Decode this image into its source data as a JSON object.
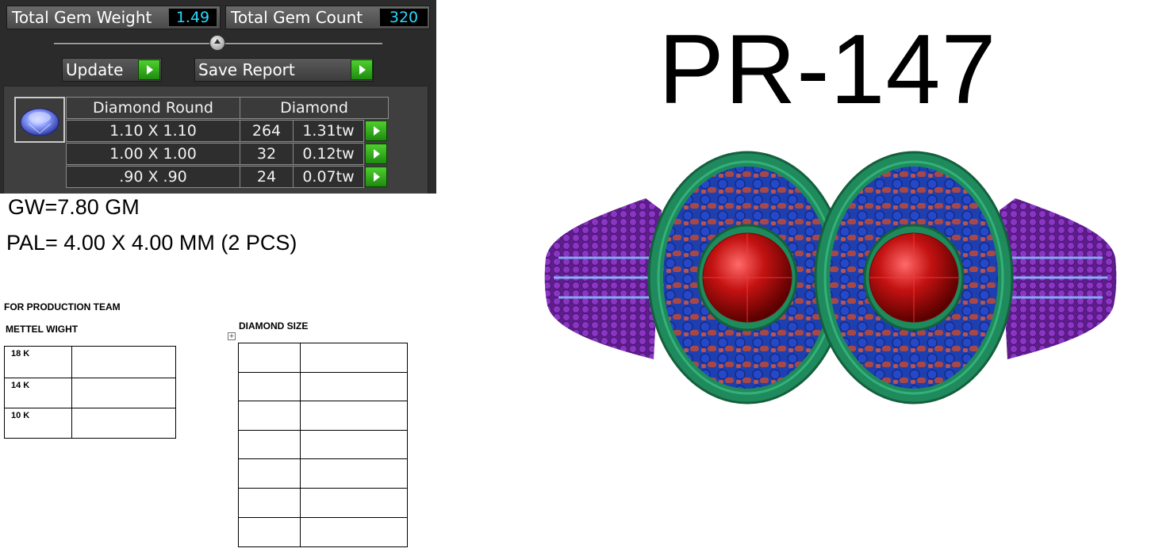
{
  "panel": {
    "total_weight_label": "Total Gem Weight",
    "total_weight_value": "1.49",
    "total_count_label": "Total Gem Count",
    "total_count_value": "320",
    "update_label": "Update",
    "save_label": "Save Report",
    "table": {
      "header_shape": "Diamond Round",
      "header_material": "Diamond",
      "rows": [
        {
          "size": "1.10 X 1.10",
          "count": "264",
          "weight": "1.31tw"
        },
        {
          "size": "1.00 X 1.00",
          "count": "32",
          "weight": "0.12tw"
        },
        {
          "size": ".90 X .90",
          "count": "24",
          "weight": "0.07tw"
        }
      ]
    }
  },
  "notes": {
    "gw": "GW=7.80 GM",
    "pal": "PAL= 4.00 X 4.00 MM (2 PCS)"
  },
  "production": {
    "title": "FOR PRODUCTION TEAM",
    "metal_title": "METTEL WIGHT",
    "metal_rows": [
      "18 K",
      "14 K",
      "10 K"
    ],
    "diamond_title": "DIAMOND SIZE"
  },
  "product": {
    "code": "PR-147"
  },
  "colors": {
    "value_text": "#2ad8ff",
    "go_button": "#2fb01a",
    "ring_band": "#7a2aa8",
    "ring_frame": "#1f8a5c",
    "side_stone": "#b04a4a",
    "center_stone": "#c41212"
  }
}
